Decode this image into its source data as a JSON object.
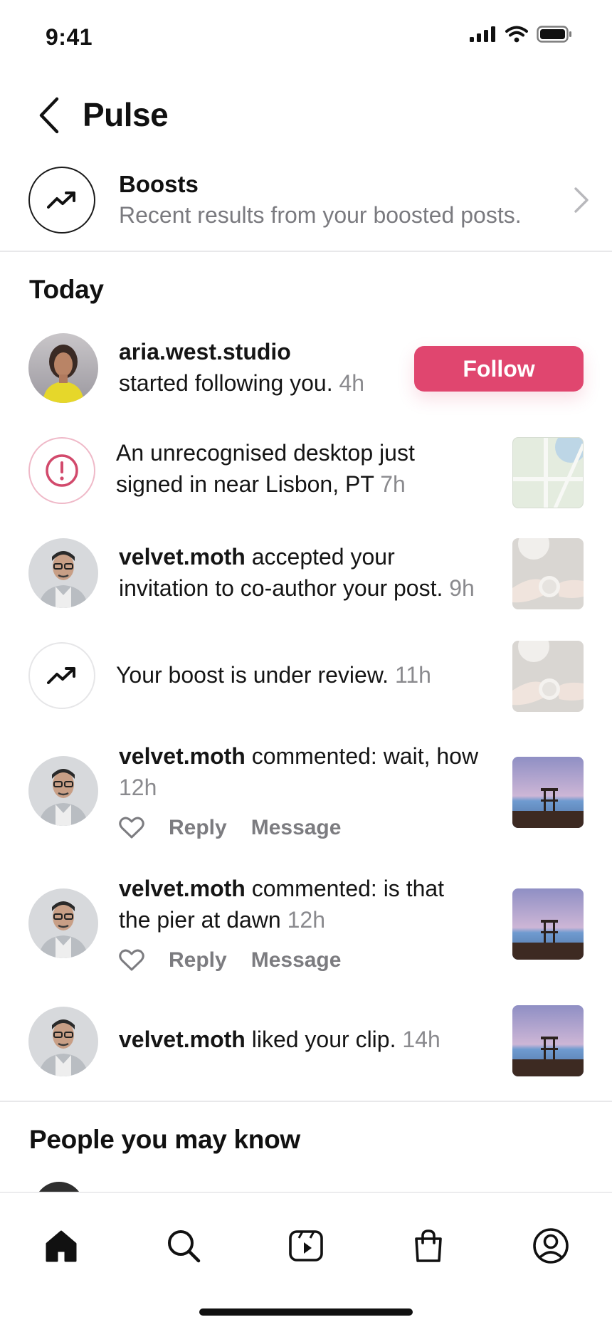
{
  "status_bar": {
    "time": "9:41"
  },
  "header": {
    "title": "Pulse"
  },
  "boosts": {
    "title": "Boosts",
    "subtitle": "Recent results from your boosted posts."
  },
  "sections": {
    "today": "Today",
    "people": "People you may know"
  },
  "notifications": [
    {
      "user": "aria.west.studio",
      "text": "started following you.",
      "time": "4h",
      "button": "Follow"
    },
    {
      "text_line1": "An unrecognised desktop just",
      "text_line2": "signed in near Lisbon, PT",
      "time": "7h"
    },
    {
      "user": "velvet.moth",
      "text_line1": "accepted your",
      "text_line2": "invitation to co-author your post.",
      "time": "9h"
    },
    {
      "text": "Your boost is under review.",
      "time": "11h"
    },
    {
      "user": "velvet.moth",
      "text": "commented: wait, how",
      "time": "12h",
      "reply": "Reply",
      "message": "Message"
    },
    {
      "user": "velvet.moth",
      "text_line1": "commented: is that",
      "text_line2": "the pier at dawn",
      "time": "12h",
      "reply": "Reply",
      "message": "Message"
    },
    {
      "user": "velvet.moth",
      "text": "liked your clip.",
      "time": "14h"
    }
  ],
  "tabbar": {
    "icons": [
      "home-icon",
      "search-icon",
      "reels-icon",
      "shop-icon",
      "profile-icon"
    ]
  },
  "colors": {
    "accent": "#e0466f",
    "alert": "#d24a6c",
    "muted": "#8a8a8e"
  }
}
